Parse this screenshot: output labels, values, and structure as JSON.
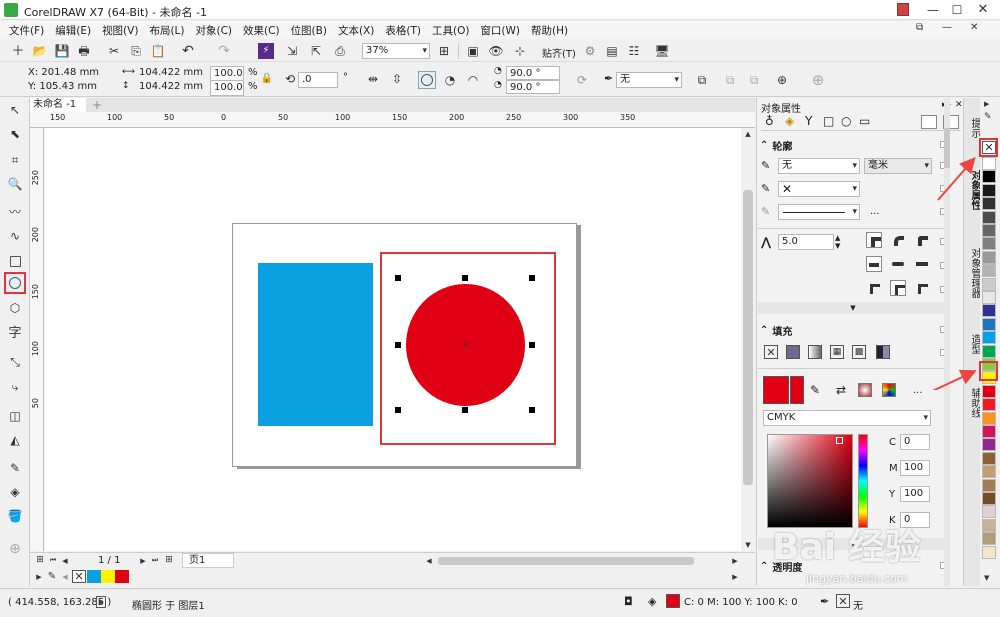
{
  "app": {
    "title": "CorelDRAW X7 (64-Bit) - 未命名 -1"
  },
  "menu": [
    "文件(F)",
    "编辑(E)",
    "视图(V)",
    "布局(L)",
    "对象(C)",
    "效果(C)",
    "位图(B)",
    "文本(X)",
    "表格(T)",
    "工具(O)",
    "窗口(W)",
    "帮助(H)"
  ],
  "toolbar": {
    "zoom": "37%",
    "snap_label": "贴齐(T)"
  },
  "propbar": {
    "x": "X: 201.48 mm",
    "y": "Y: 105.43 mm",
    "w": "104.422 mm",
    "h": "104.422 mm",
    "sx": "100.0",
    "sy": "100.0",
    "pct": "%",
    "angle": ".0",
    "deg": "°",
    "start_angle": "90.0 °",
    "end_angle": "90.0 °",
    "outline": "无"
  },
  "doc_tab": "未命名 -1",
  "ruler": {
    "h_ticks": [
      "150",
      "100",
      "50",
      "0",
      "50",
      "100",
      "150",
      "200",
      "250",
      "300",
      "350"
    ],
    "v_ticks": [
      "250",
      "200",
      "150",
      "100",
      "50"
    ]
  },
  "pages": {
    "current": "1 / 1",
    "tab": "页1"
  },
  "docker": {
    "title": "对象属性",
    "outline": {
      "title": "轮廓",
      "width": "无",
      "unit": "毫米",
      "miter": "5.0",
      "more": "..."
    },
    "fill": {
      "title": "填充",
      "model": "CMYK",
      "c_label": "C",
      "c": "0",
      "m_label": "M",
      "m": "100",
      "y_label": "Y",
      "y": "100",
      "k_label": "K",
      "k": "0",
      "more": "..."
    },
    "transparency": {
      "title": "透明度"
    },
    "side_tabs": [
      "提示",
      "对象属性",
      "对象管理器",
      "造型",
      "辅助线"
    ]
  },
  "status": {
    "coords": "( 414.558, 163.285 )",
    "object": "椭圆形 于 图层1",
    "fill_info": "C: 0 M: 100 Y: 100 K: 0",
    "outline": "无"
  },
  "colors": {
    "accent_red": "#e00013",
    "blue": "#0aa0e0",
    "highlight": "#d9373a"
  },
  "watermark": {
    "main": "Bai 经验",
    "sub": "jingyan.baidu.com"
  },
  "palette": [
    "#ffffff",
    "#000000",
    "#1a1a1a",
    "#333333",
    "#4d4d4d",
    "#666666",
    "#808080",
    "#999999",
    "#b3b3b3",
    "#cccccc",
    "#e6e6e6",
    "#2e3192",
    "#1e73be",
    "#00a0e9",
    "#00a651",
    "#8dc63f",
    "#fff200",
    "#e00013",
    "#ed1c24",
    "#f7941d",
    "#d4145a",
    "#92278f",
    "#8c6239",
    "#c69c6d",
    "#a67c52",
    "#754c24",
    "#e4cfd0",
    "#c7b299",
    "#b29d7a",
    "#f5e6c8"
  ],
  "doc_palette": [
    "#0aa0e0",
    "#fff200",
    "#e00013"
  ]
}
